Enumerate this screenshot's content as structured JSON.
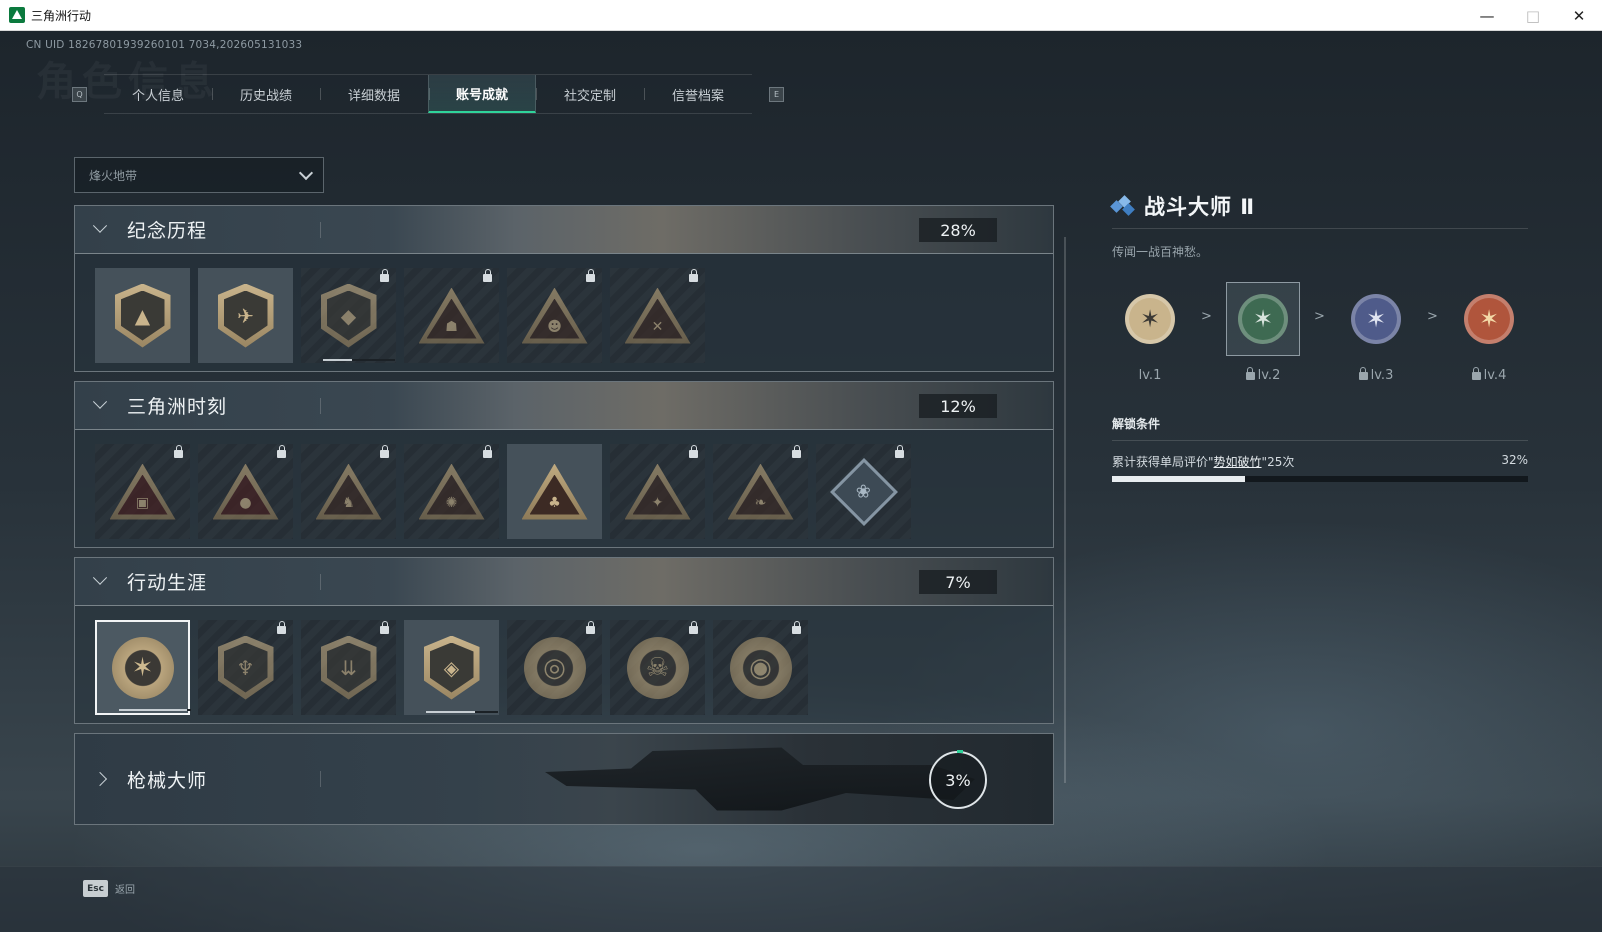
{
  "window": {
    "title": "三角洲行动"
  },
  "uid_text": "CN UID 18267801939260101 7034,202605131033",
  "watermark": "角色信息",
  "tabs": {
    "left_key": "Q",
    "right_key": "E",
    "items": [
      {
        "label": "个人信息"
      },
      {
        "label": "历史战绩"
      },
      {
        "label": "详细数据"
      },
      {
        "label": "账号成就",
        "active": true
      },
      {
        "label": "社交定制"
      },
      {
        "label": "信誉档案"
      }
    ]
  },
  "mode_select": {
    "value": "烽火地带"
  },
  "sections": [
    {
      "title": "纪念历程",
      "percent": "28%",
      "expanded": true,
      "badge_count": 6
    },
    {
      "title": "三角洲时刻",
      "percent": "12%",
      "expanded": true,
      "badge_count": 8
    },
    {
      "title": "行动生涯",
      "percent": "7%",
      "expanded": true,
      "badge_count": 7
    },
    {
      "title": "枪械大师",
      "percent": "3%",
      "expanded": false,
      "badge_count": 0
    }
  ],
  "detail": {
    "name": "战斗大师 Ⅱ",
    "description": "传闻一战百神愁。",
    "levels": [
      {
        "label": "lv.1",
        "locked": false,
        "color": "#c9b48c"
      },
      {
        "label": "lv.2",
        "locked": true,
        "current": true,
        "color": "#3e6a52"
      },
      {
        "label": "lv.3",
        "locked": true,
        "color": "#4f5b8a"
      },
      {
        "label": "lv.4",
        "locked": true,
        "color": "#b0553c"
      }
    ],
    "level_separator": ">",
    "unlock_title": "解锁条件",
    "condition_prefix": "累计获得单局评价\"",
    "condition_link": "势如破竹",
    "condition_suffix": "\"25次",
    "condition_percent": "32%",
    "condition_progress": 0.32
  },
  "footer": {
    "esc_key": "Esc",
    "back_label": "返回"
  },
  "colors": {
    "accent": "#2fd39a",
    "detail_icon": "#5a95d6"
  }
}
